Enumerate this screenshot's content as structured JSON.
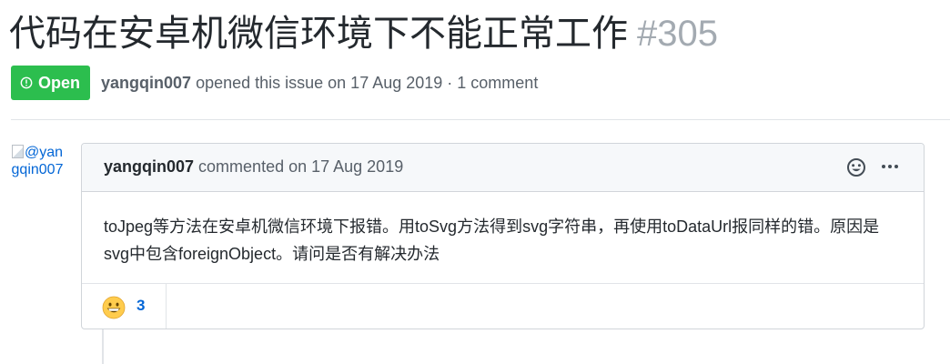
{
  "issue": {
    "title": "代码在安卓机微信环境下不能正常工作",
    "number": "#305",
    "state": "Open",
    "author": "yangqin007",
    "summary": " opened this issue on 17 Aug 2019 · 1 comment"
  },
  "comment": {
    "avatar_alt": "@yangqin007",
    "author": "yangqin007",
    "meta": " commented on 17 Aug 2019",
    "body": "toJpeg等方法在安卓机微信环境下报错。用toSvg方法得到svg字符串，再使用toDataUrl报同样的错。原因是svg中包含foreignObject。请问是否有解决办法",
    "reactions": [
      {
        "emoji": "grinning-face",
        "count": "3"
      }
    ]
  },
  "icons": {
    "state": "issue-opened-icon",
    "reaction_picker": "smiley-icon",
    "more_actions": "kebab-horizontal-icon"
  },
  "colors": {
    "open": "#2cbe4e",
    "link": "#0366d6",
    "muted": "#586069",
    "number": "#a3aab1"
  }
}
